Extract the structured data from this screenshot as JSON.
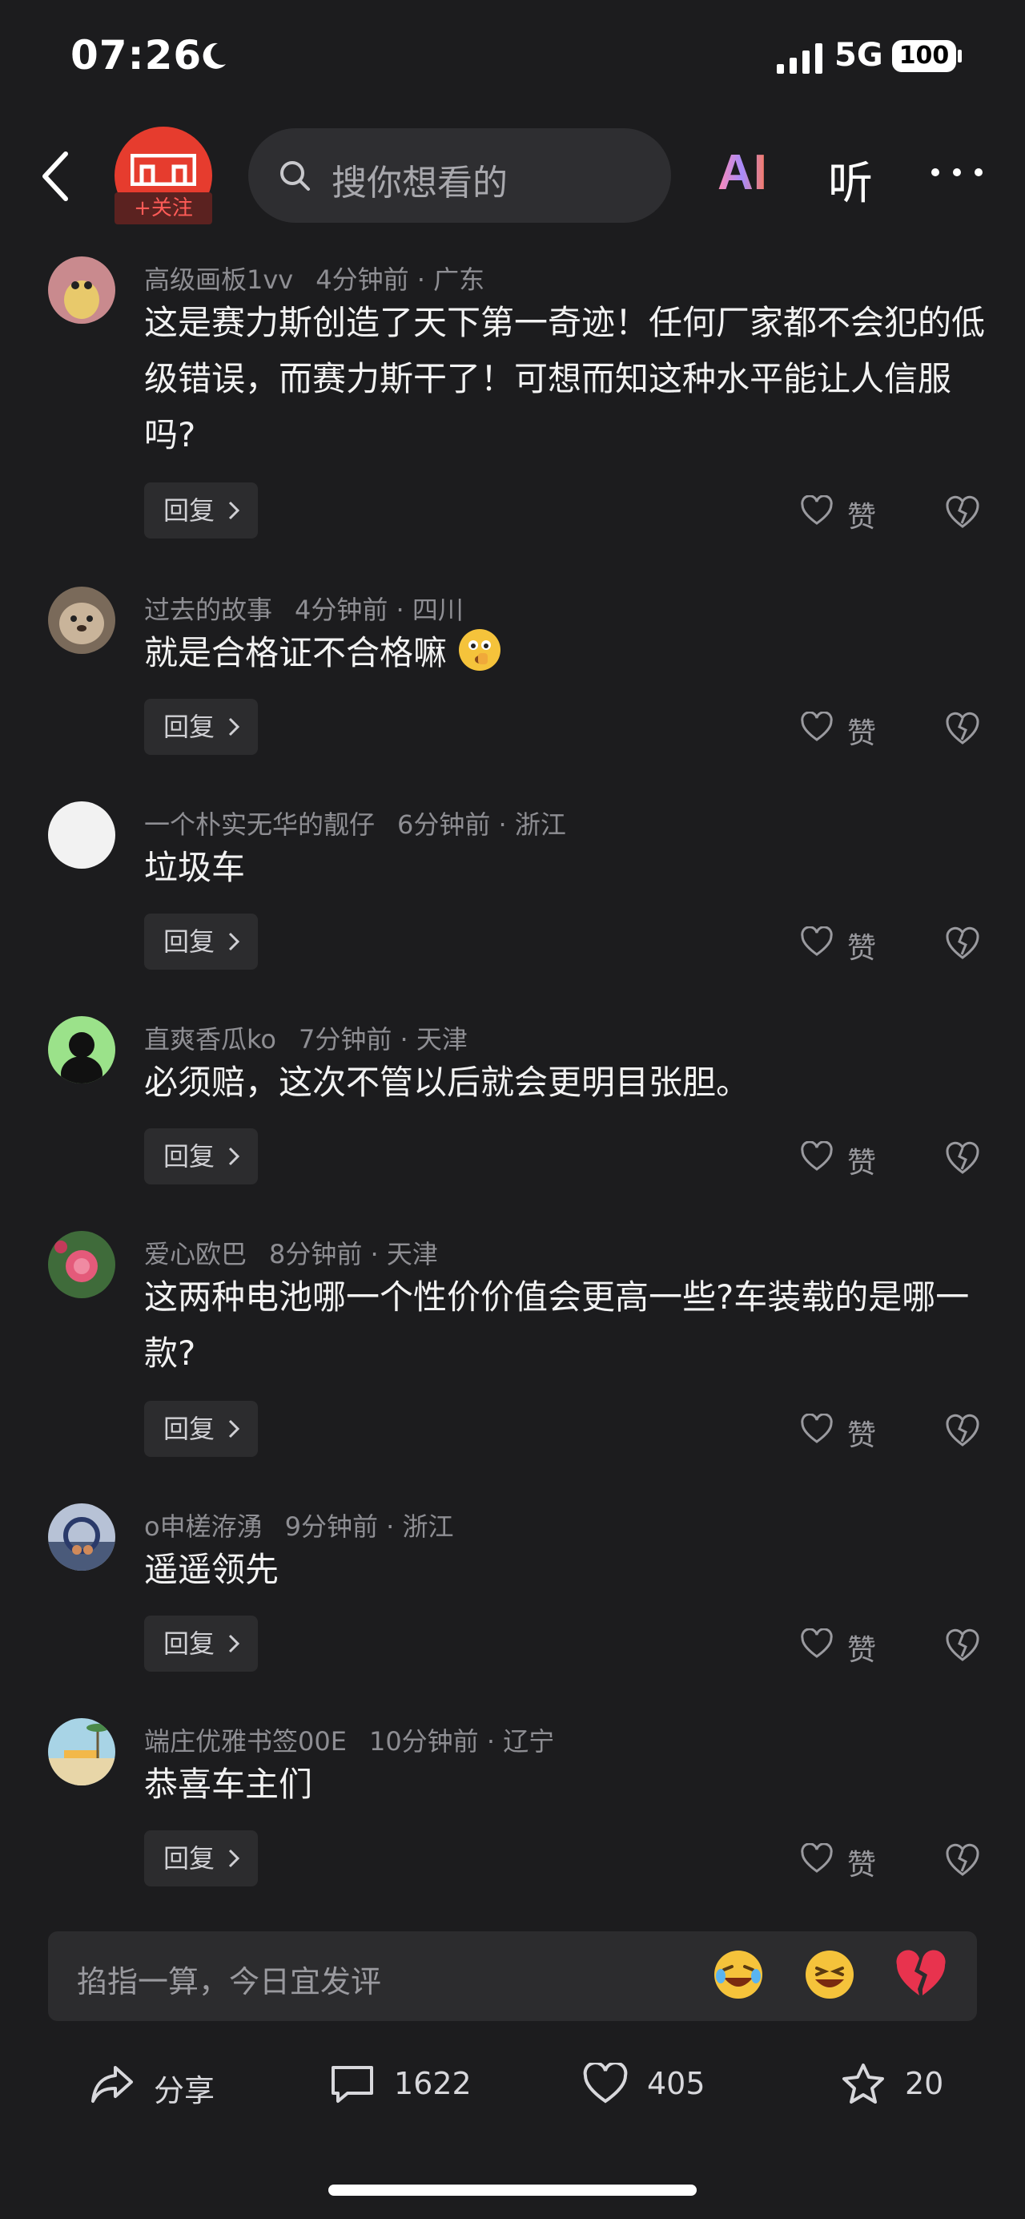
{
  "status_bar": {
    "time": "07:26",
    "network": "5G",
    "battery": "100"
  },
  "header": {
    "follow_label": "+关注",
    "search_placeholder": "搜你想看的",
    "ai_label": "AI",
    "listen_label": "听"
  },
  "comments": [
    {
      "user": "高级画板1vv",
      "time": "4分钟前 · 广东",
      "text": "这是赛力斯创造了天下第一奇迹！任何厂家都不会犯的低级错误，而赛力斯干了！可想而知这种水平能让人信服吗?",
      "reply": "回复",
      "like": "赞"
    },
    {
      "user": "过去的故事",
      "time": "4分钟前 · 四川",
      "text": "就是合格证不合格嘛",
      "reply": "回复",
      "like": "赞"
    },
    {
      "user": "一个朴实无华的靓仔",
      "time": "6分钟前 · 浙江",
      "text": "垃圾车",
      "reply": "回复",
      "like": "赞"
    },
    {
      "user": "直爽香瓜ko",
      "time": "7分钟前 · 天津",
      "text": "必须赔，这次不管以后就会更明目张胆。",
      "reply": "回复",
      "like": "赞"
    },
    {
      "user": "爱心欧巴",
      "time": "8分钟前 · 天津",
      "text": "这两种电池哪一个性价价值会更高一些?车装载的是哪一款?",
      "reply": "回复",
      "like": "赞"
    },
    {
      "user": "o申槎洊湧",
      "time": "9分钟前 · 浙江",
      "text": "遥遥领先",
      "reply": "回复",
      "like": "赞"
    },
    {
      "user": "端庄优雅书签00E",
      "time": "10分钟前 · 辽宁",
      "text": "恭喜车主们",
      "reply": "回复",
      "like": "赞"
    }
  ],
  "composer": {
    "placeholder": "掐指一算，今日宜发评"
  },
  "bottom_bar": {
    "share_label": "分享",
    "comment_count": "1622",
    "like_count": "405",
    "favorite_count": "20"
  }
}
